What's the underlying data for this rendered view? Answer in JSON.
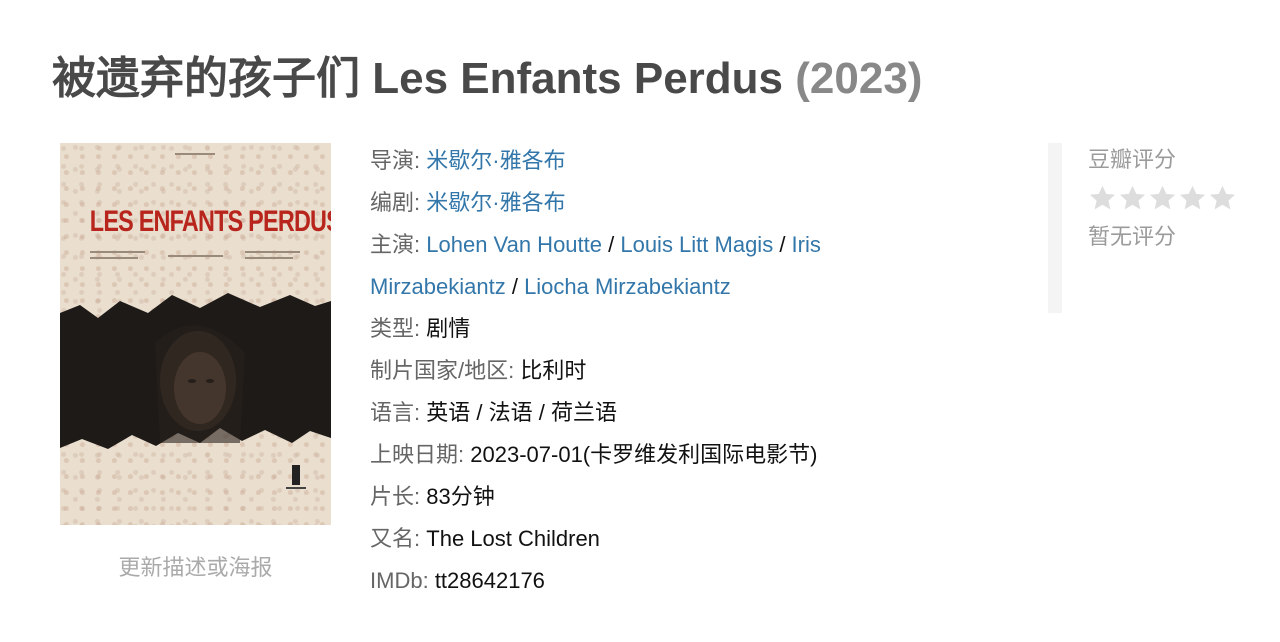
{
  "movie": {
    "title_cn": "被遗弃的孩子们",
    "title_en": "Les Enfants Perdus",
    "year": "(2023)"
  },
  "poster": {
    "title_text": "LES ENFANTS PERDUS",
    "update_link": "更新描述或海报"
  },
  "info": {
    "director_label": "导演",
    "director": "米歇尔·雅各布",
    "writer_label": "编剧",
    "writer": "米歇尔·雅各布",
    "cast_label": "主演",
    "cast": [
      "Lohen Van Houtte",
      "Louis Litt Magis",
      "Iris",
      "Mirzabekiantz",
      "Liocha Mirzabekiantz"
    ],
    "genre_label": "类型",
    "genre": "剧情",
    "country_label": "制片国家/地区",
    "country": "比利时",
    "language_label": "语言",
    "language": "英语 / 法语 / 荷兰语",
    "release_label": "上映日期",
    "release": "2023-07-01(卡罗维发利国际电影节)",
    "runtime_label": "片长",
    "runtime": "83分钟",
    "aka_label": "又名",
    "aka": "The Lost Children",
    "imdb_label": "IMDb",
    "imdb": "tt28642176",
    "colon": ":",
    "slash": " / "
  },
  "rating": {
    "label": "豆瓣评分",
    "stars_filled": 0,
    "stars_total": 5,
    "no_rating": "暂无评分",
    "star_color": "#dddddd",
    "star_icon": "star-icon"
  },
  "colors": {
    "link": "#3377aa",
    "label": "#666666",
    "title": "#494949",
    "year": "#888888"
  }
}
